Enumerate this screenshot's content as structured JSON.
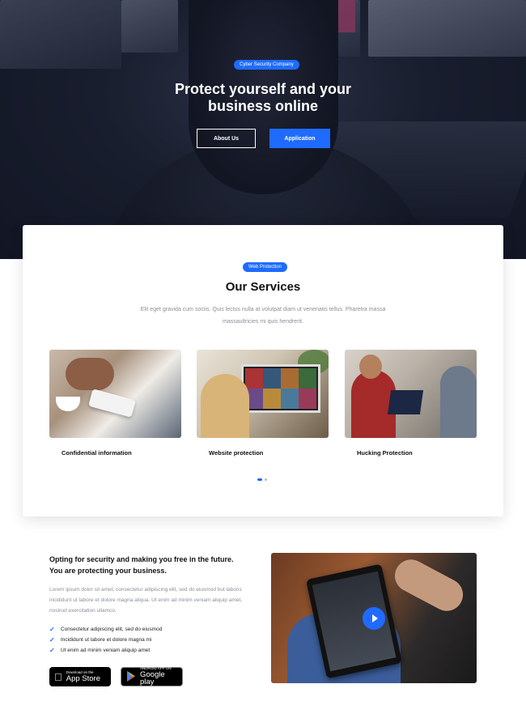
{
  "hero": {
    "badge": "Cyber Security Company",
    "title": "Protect yourself and your business online",
    "buttons": {
      "about": "About Us",
      "application": "Application"
    }
  },
  "services": {
    "badge": "Web Protection",
    "title": "Our Services",
    "description": "Elit eget gravida cum sociis. Quis lectus nulla at volutpat diam ut venenatis tellus. Pharetra massa massaultricies mi quis hendrerit.",
    "items": [
      {
        "title": "Confidential information"
      },
      {
        "title": "Website protection"
      },
      {
        "title": "Hucking Protection"
      }
    ]
  },
  "feature": {
    "title": "Opting for security and making you free in the future. You are protecting your business.",
    "description": "Lorem ipsum dolor sit amet, consectetur adipiscing elit, sed do eiusmod but laboris incididunt ut labore et dolore magna aliqua. Ut enim ad minim veniam aliquip amet, nostrud exercitation ullamco.",
    "checklist": [
      "Consectetur adipiscing elit, sed do eiusmod",
      "Incididunt ut labore et dolore magna mi",
      "Ut enim ad minim veniam aliquip amet"
    ],
    "stores": {
      "apple": {
        "small": "Download on the",
        "big": "App Store"
      },
      "google": {
        "small": "ANDROID APP ON",
        "big": "Google play"
      }
    }
  },
  "colors": {
    "accent": "#1f6bff",
    "hero_bg": "#1a1f2e",
    "muted_text": "#8a8f99"
  }
}
